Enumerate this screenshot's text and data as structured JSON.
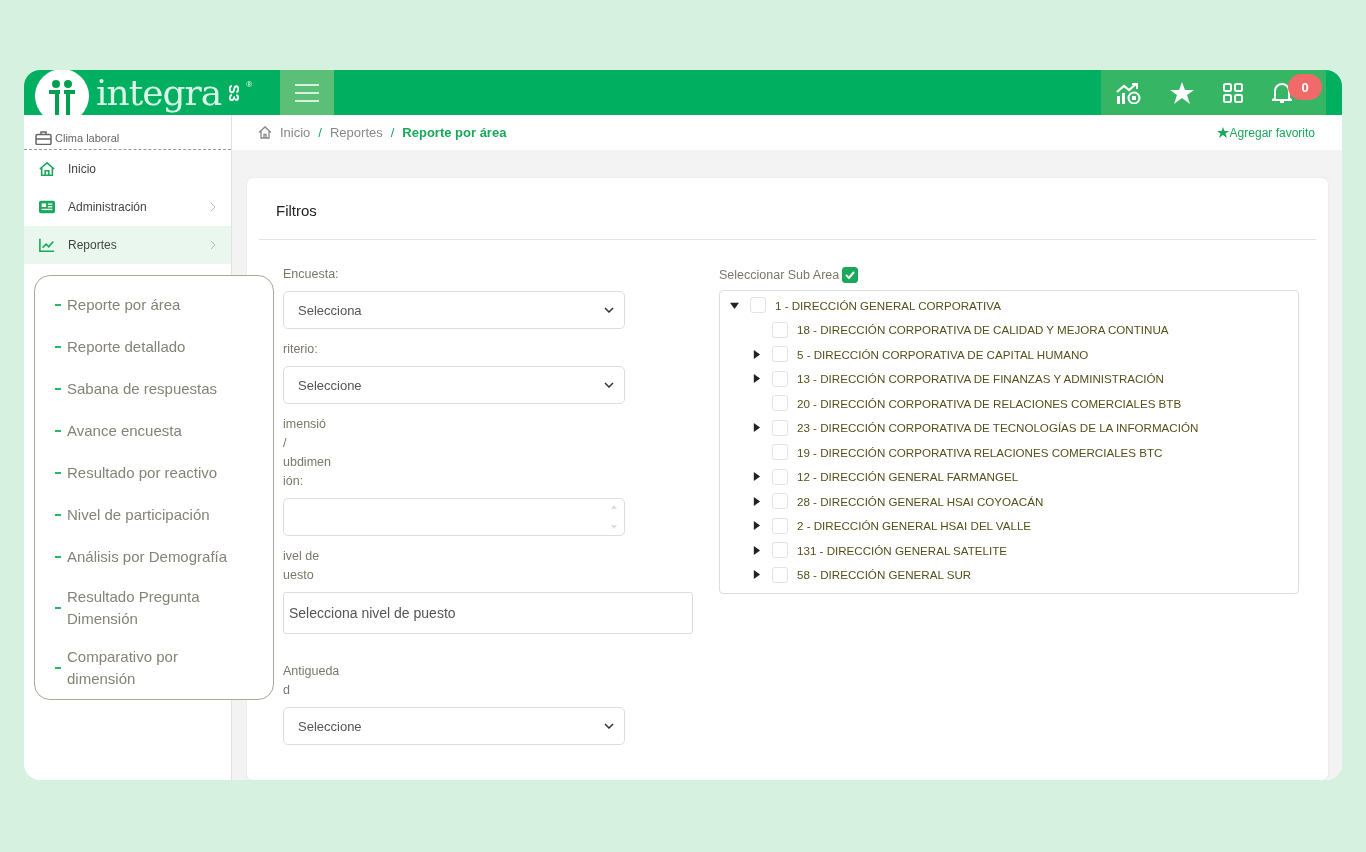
{
  "header": {
    "logo": {
      "name": "integra",
      "mark": "S3",
      "registered": "®"
    },
    "notifications": "0"
  },
  "sidebar": {
    "module": "Clima laboral",
    "items": [
      {
        "label": "Inicio",
        "selected": false,
        "chevron": false
      },
      {
        "label": "Administración",
        "selected": false,
        "chevron": true
      },
      {
        "label": "Reportes",
        "selected": true,
        "chevron": true
      }
    ]
  },
  "submenu": {
    "items": [
      "Reporte por área",
      "Reporte detallado",
      "Sabana de respuestas",
      "Avance encuesta",
      "Resultado por reactivo",
      "Nivel de participación",
      "Análisis por Demografía",
      "Resultado Pregunta Dimensión",
      "Comparativo por dimensión"
    ]
  },
  "breadcrumb": {
    "items": [
      {
        "label": "Inicio",
        "current": false
      },
      {
        "separator": "/",
        "label": "Reportes",
        "current": false
      },
      {
        "separator": "/",
        "label": "Reporte por área",
        "current": true
      }
    ],
    "favorite": "Agregar favorito"
  },
  "filters": {
    "title": "Filtros",
    "fields": [
      {
        "kind": "select",
        "label": [
          "Encuesta:"
        ],
        "value": "Selecciona"
      },
      {
        "kind": "select",
        "label": [
          "riterio:"
        ],
        "value": "Seleccione"
      },
      {
        "kind": "listbox",
        "label": [
          "imensió",
          "/",
          "ubdimen",
          "ión:"
        ]
      },
      {
        "kind": "multiselect",
        "label": [
          "ivel de",
          "uesto"
        ],
        "value": "Selecciona nivel de puesto"
      },
      {
        "kind": "select",
        "label": [
          "Antigueda",
          "d"
        ],
        "value": "Seleccione"
      }
    ],
    "subarea": {
      "label": "Seleccionar Sub Area",
      "checked": true,
      "nodes": [
        {
          "label": "1 - DIRECCIÓN GENERAL CORPORATIVA",
          "kind": "branch",
          "expanded": true,
          "checked": false,
          "children": [
            {
              "label": "18 - DIRECCIÓN CORPORATIVA DE CALIDAD Y MEJORA CONTINUA",
              "kind": "leaf",
              "checked": false
            },
            {
              "label": "5 - DIRECCIÓN CORPORATIVA DE CAPITAL HUMANO",
              "kind": "branch",
              "expanded": false,
              "checked": false
            },
            {
              "label": "13 - DIRECCIÓN CORPORATIVA DE FINANZAS Y ADMINISTRACIÓN",
              "kind": "branch",
              "expanded": false,
              "checked": false
            },
            {
              "label": "20 - DIRECCIÓN CORPORATIVA DE RELACIONES COMERCIALES BTB",
              "kind": "leaf",
              "checked": false
            },
            {
              "label": "23 - DIRECCIÓN CORPORATIVA DE TECNOLOGÍAS DE LA INFORMACIÓN",
              "kind": "branch",
              "expanded": false,
              "checked": false
            },
            {
              "label": "19 - DIRECCIÓN CORPORATIVA RELACIONES COMERCIALES BTC",
              "kind": "leaf",
              "checked": false
            },
            {
              "label": "12 - DIRECCIÓN GENERAL FARMANGEL",
              "kind": "branch",
              "expanded": false,
              "checked": false
            },
            {
              "label": "28 - DIRECCIÓN GENERAL HSAI COYOACÁN",
              "kind": "branch",
              "expanded": false,
              "checked": false
            },
            {
              "label": "2 - DIRECCIÓN GENERAL HSAI DEL VALLE",
              "kind": "branch",
              "expanded": false,
              "checked": false
            },
            {
              "label": "131 - DIRECCIÓN GENERAL SATELITE",
              "kind": "branch",
              "expanded": false,
              "checked": false
            },
            {
              "label": "58 - DIRECCIÓN GENERAL SUR",
              "kind": "branch",
              "expanded": false,
              "checked": false
            }
          ]
        }
      ]
    }
  }
}
